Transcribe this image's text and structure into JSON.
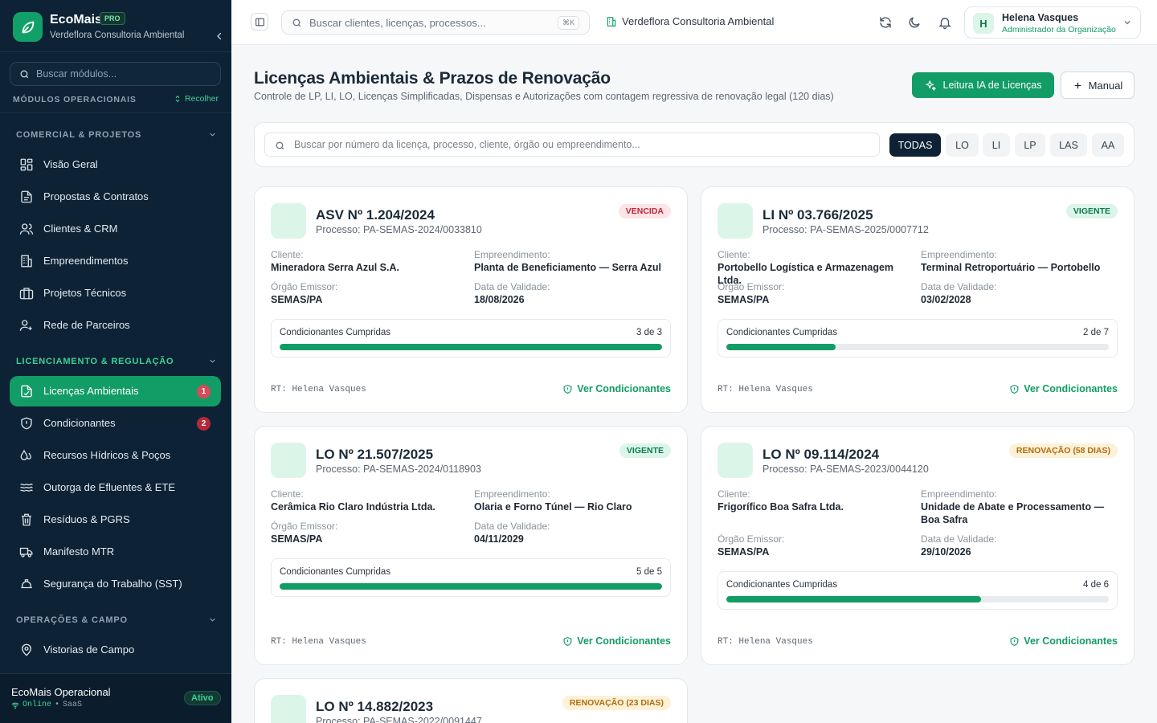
{
  "brand": {
    "name": "EcoMais",
    "tag": "PRO",
    "org": "Verdeflora Consultoria Ambiental"
  },
  "sidebar": {
    "search_placeholder": "Buscar módulos...",
    "modules_label": "MÓDULOS OPERACIONAIS",
    "collapse_label": "Recolher",
    "sections": {
      "comercial": "COMERCIAL & PROJETOS",
      "licenciamento": "LICENCIAMENTO & REGULAÇÃO",
      "operacoes": "OPERAÇÕES & CAMPO"
    },
    "items": [
      {
        "label": "Visão Geral",
        "icon": "grid-icon"
      },
      {
        "label": "Propostas & Contratos",
        "icon": "document-icon"
      },
      {
        "label": "Clientes & CRM",
        "icon": "users-icon"
      },
      {
        "label": "Empreendimentos",
        "icon": "building-icon"
      },
      {
        "label": "Projetos Técnicos",
        "icon": "briefcase-icon"
      },
      {
        "label": "Rede de Parceiros",
        "icon": "user-plus-icon"
      },
      {
        "label": "Licenças Ambientais",
        "icon": "license-icon",
        "badge": "1",
        "active": true
      },
      {
        "label": "Condicionantes",
        "icon": "shield-icon",
        "badge": "2"
      },
      {
        "label": "Recursos Hídricos & Poços",
        "icon": "droplet-icon"
      },
      {
        "label": "Outorga de Efluentes & ETE",
        "icon": "waves-icon"
      },
      {
        "label": "Resíduos & PGRS",
        "icon": "trash-icon"
      },
      {
        "label": "Manifesto MTR",
        "icon": "truck-icon"
      },
      {
        "label": "Segurança do Trabalho (SST)",
        "icon": "hardhat-icon"
      },
      {
        "label": "Vistorias de Campo",
        "icon": "map-pin-icon"
      }
    ],
    "footer": {
      "title": "EcoMais Operacional",
      "online": "Online",
      "sep": "•",
      "mode": "SaaS",
      "status": "Ativo"
    }
  },
  "topbar": {
    "search_placeholder": "Buscar clientes, licenças, processos...",
    "shortcut": "⌘K",
    "org": "Verdeflora Consultoria Ambiental",
    "user": {
      "initial": "H",
      "name": "Helena Vasques",
      "role": "Administrador da Organização"
    }
  },
  "page": {
    "title": "Licenças Ambientais & Prazos de Renovação",
    "subtitle": "Controle de LP, LI, LO, Licenças Simplificadas, Dispensas e Autorizações com contagem regressiva de renovação legal (120 dias)",
    "ai_button": "Leitura IA de Licenças",
    "manual_button": "Manual"
  },
  "filters": {
    "search_placeholder": "Buscar por número da licença, processo, cliente, órgão ou empreendimento...",
    "tabs": [
      "TODAS",
      "LO",
      "LI",
      "LP",
      "LAS",
      "AA"
    ],
    "active": "TODAS"
  },
  "labels": {
    "cliente": "Cliente:",
    "empreendimento": "Empreendimento:",
    "orgao": "Órgão Emissor:",
    "validade": "Data de Validade:",
    "condicionantes": "Condicionantes Cumpridas",
    "ver": "Ver Condicionantes",
    "rt_prefix": "RT:"
  },
  "colors": {
    "accent": "#129c66",
    "sidebar": "#0d2234",
    "danger": "#c0283a",
    "warning": "#b06d0d"
  },
  "licenses": [
    {
      "title": "ASV Nº 1.204/2024",
      "process": "Processo: PA-SEMAS-2024/0033810",
      "status": "VENCIDA",
      "status_kind": "red",
      "client": "Mineradora Serra Azul S.A.",
      "enterprise": "Planta de Beneficiamento — Serra Azul",
      "agency": "SEMAS/PA",
      "validity": "18/08/2026",
      "cond_text": "3 de 3",
      "cond_done": 3,
      "cond_total": 3,
      "rt": "Helena Vasques"
    },
    {
      "title": "LI Nº 03.766/2025",
      "process": "Processo: PA-SEMAS-2025/0007712",
      "status": "VIGENTE",
      "status_kind": "green",
      "client": "Portobello Logística e Armazenagem Ltda.",
      "enterprise": "Terminal Retroportuário — Portobello",
      "agency": "SEMAS/PA",
      "validity": "03/02/2028",
      "cond_text": "2 de 7",
      "cond_done": 2,
      "cond_total": 7,
      "rt": "Helena Vasques"
    },
    {
      "title": "LO Nº 21.507/2025",
      "process": "Processo: PA-SEMAS-2024/0118903",
      "status": "VIGENTE",
      "status_kind": "green",
      "client": "Cerâmica Rio Claro Indústria Ltda.",
      "enterprise": "Olaria e Forno Túnel — Rio Claro",
      "agency": "SEMAS/PA",
      "validity": "04/11/2029",
      "cond_text": "5 de 5",
      "cond_done": 5,
      "cond_total": 5,
      "rt": "Helena Vasques"
    },
    {
      "title": "LO Nº 09.114/2024",
      "process": "Processo: PA-SEMAS-2023/0044120",
      "status": "RENOVAÇÃO (58 DIAS)",
      "status_kind": "amber",
      "client": "Frigorífico Boa Safra Ltda.",
      "enterprise": "Unidade de Abate e Processamento — Boa Safra",
      "agency": "SEMAS/PA",
      "validity": "29/10/2026",
      "cond_text": "4 de 6",
      "cond_done": 4,
      "cond_total": 6,
      "rt": "Helena Vasques"
    },
    {
      "title": "LO Nº 14.882/2023",
      "process": "Processo: PA-SEMAS-2022/0091447",
      "status": "RENOVAÇÃO (23 DIAS)",
      "status_kind": "amber"
    }
  ]
}
